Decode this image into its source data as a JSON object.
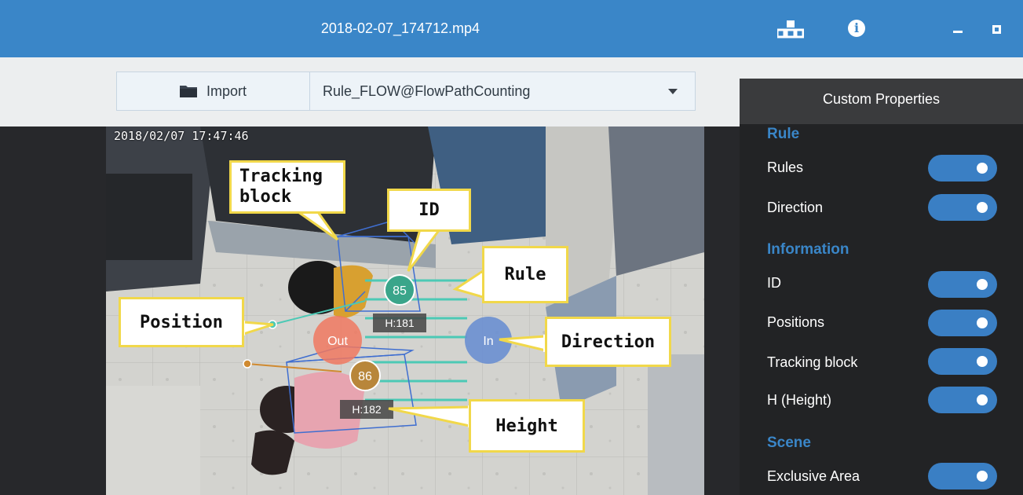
{
  "titlebar": {
    "filename": "2018-02-07_174712.mp4",
    "icons": [
      "grid-icon",
      "info-icon",
      "minimize-icon",
      "maximize-icon"
    ]
  },
  "toolbar": {
    "import_label": "Import",
    "rule_selected": "Rule_FLOW@FlowPathCounting"
  },
  "video": {
    "timestamp": "2018/02/07 17:47:46",
    "object_ids": [
      "85",
      "86"
    ],
    "heights": [
      "H:181",
      "H:182"
    ],
    "zone_labels": {
      "out": "Out",
      "in": "In"
    }
  },
  "callouts": {
    "tracking_block": "Tracking\nblock",
    "id": "ID",
    "rule": "Rule",
    "position": "Position",
    "direction": "Direction",
    "height": "Height"
  },
  "panel": {
    "header": "Custom Properties",
    "sections": [
      {
        "title": "Rule",
        "items": [
          {
            "label": "Rules",
            "on": true
          },
          {
            "label": "Direction",
            "on": true
          }
        ]
      },
      {
        "title": "Information",
        "items": [
          {
            "label": "ID",
            "on": true
          },
          {
            "label": "Positions",
            "on": true
          },
          {
            "label": "Tracking block",
            "on": true
          },
          {
            "label": "H (Height)",
            "on": true
          }
        ]
      },
      {
        "title": "Scene",
        "items": [
          {
            "label": "Exclusive Area",
            "on": true
          }
        ]
      }
    ]
  },
  "colors": {
    "accent": "#3a86c8",
    "toggle": "#3a7fc4",
    "callout_border": "#f1d84a",
    "id85": "#3aa58a",
    "id86": "#b8863a",
    "out_zone": "#f07860",
    "in_zone": "#6a8fd0"
  }
}
